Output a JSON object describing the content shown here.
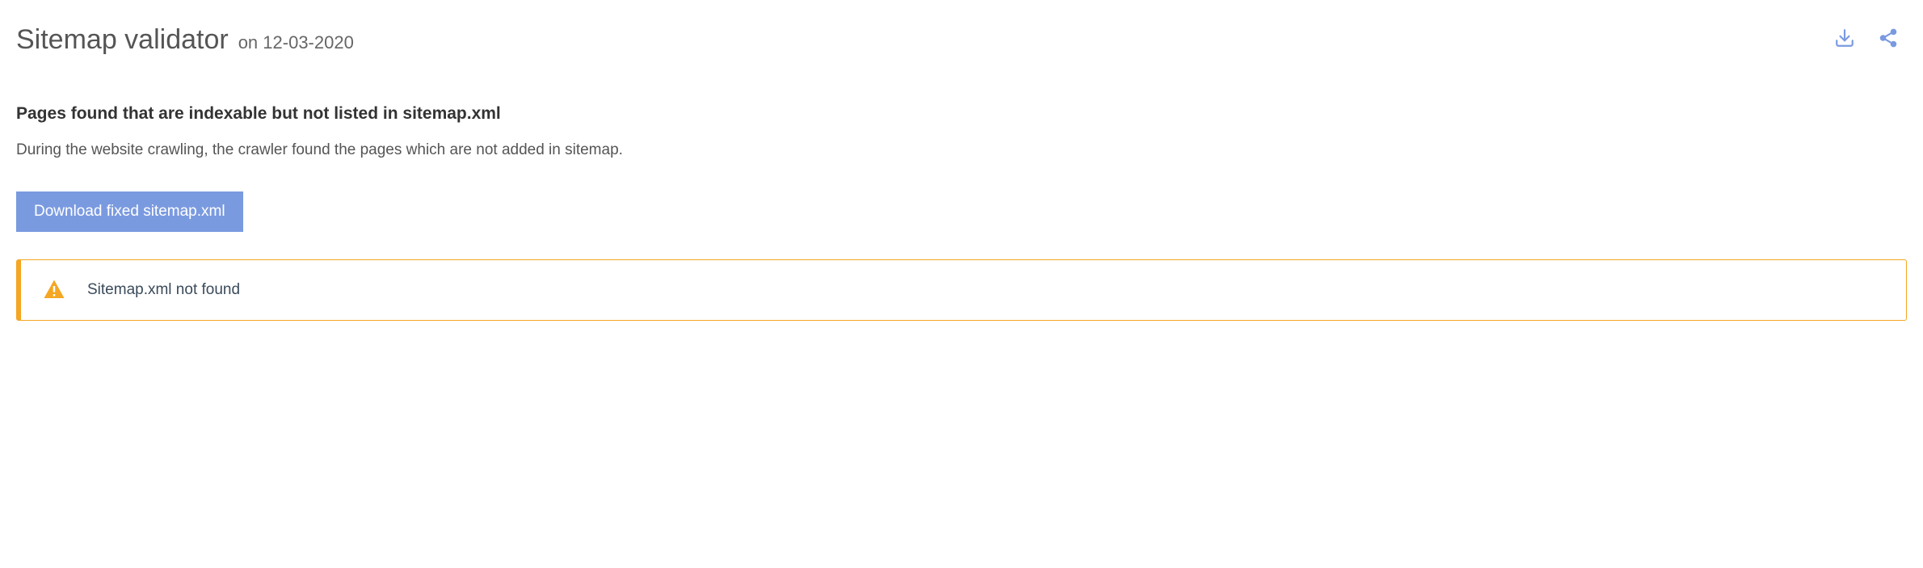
{
  "header": {
    "title": "Sitemap validator",
    "date_prefix": "on ",
    "date": "12-03-2020"
  },
  "section": {
    "heading": "Pages found that are indexable but not listed in sitemap.xml",
    "description": "During the website crawling, the crawler found the pages which are not added in sitemap."
  },
  "actions": {
    "download_label": "Download fixed sitemap.xml"
  },
  "alert": {
    "message": "Sitemap.xml not found"
  },
  "colors": {
    "accent_blue": "#7a9ae0",
    "warn_orange": "#f5a623",
    "icon_blue": "#7a9ae0"
  }
}
